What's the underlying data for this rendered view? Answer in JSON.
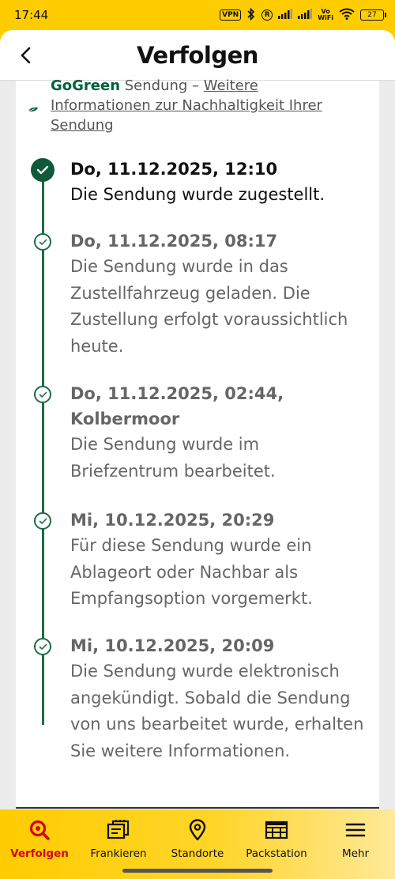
{
  "status_bar": {
    "time": "17:44",
    "vpn": "VPN",
    "r_badge": "R",
    "vowifi_top": "Vo",
    "vowifi_bottom": "WiFi",
    "battery": "27"
  },
  "header": {
    "title": "Verfolgen"
  },
  "gogreen": {
    "brand": "GoGreen",
    "text": " Sendung – ",
    "link": "Weitere Informationen zur Nachhaltigkeit Ihrer Sendung"
  },
  "events": [
    {
      "date": "Do, 11.12.2025, 12:10",
      "description": "Die Sendung wurde zugestellt.",
      "state": "current"
    },
    {
      "date": "Do, 11.12.2025, 08:17",
      "description": "Die Sendung wurde in das Zustellfahrzeug geladen. Die Zustellung erfolgt voraussichtlich heute.",
      "state": "past"
    },
    {
      "date": "Do, 11.12.2025, 02:44, Kolbermoor",
      "description": "Die Sendung wurde im Briefzentrum bearbeitet.",
      "state": "past"
    },
    {
      "date": "Mi, 10.12.2025, 20:29",
      "description": "Für diese Sendung wurde ein Ablageort oder Nachbar als Empfangsoption vorgemerkt.",
      "state": "past"
    },
    {
      "date": "Mi, 10.12.2025, 20:09",
      "description": "Die Sendung wurde elektronisch angekündigt. Sobald die Sendung von uns bearbeitet wurde, erhalten Sie weitere Informationen.",
      "state": "past"
    }
  ],
  "bottom_nav": {
    "items": [
      {
        "label": "Verfolgen",
        "icon": "search-icon",
        "active": true
      },
      {
        "label": "Frankieren",
        "icon": "stamp-icon",
        "active": false
      },
      {
        "label": "Standorte",
        "icon": "location-pin-icon",
        "active": false
      },
      {
        "label": "Packstation",
        "icon": "packstation-icon",
        "active": false
      },
      {
        "label": "Mehr",
        "icon": "menu-icon",
        "active": false
      }
    ]
  },
  "colors": {
    "brand_yellow": "#ffcc00",
    "brand_red": "#d40511",
    "timeline_green": "#1e6b46",
    "gogreen_green": "#00613a"
  }
}
